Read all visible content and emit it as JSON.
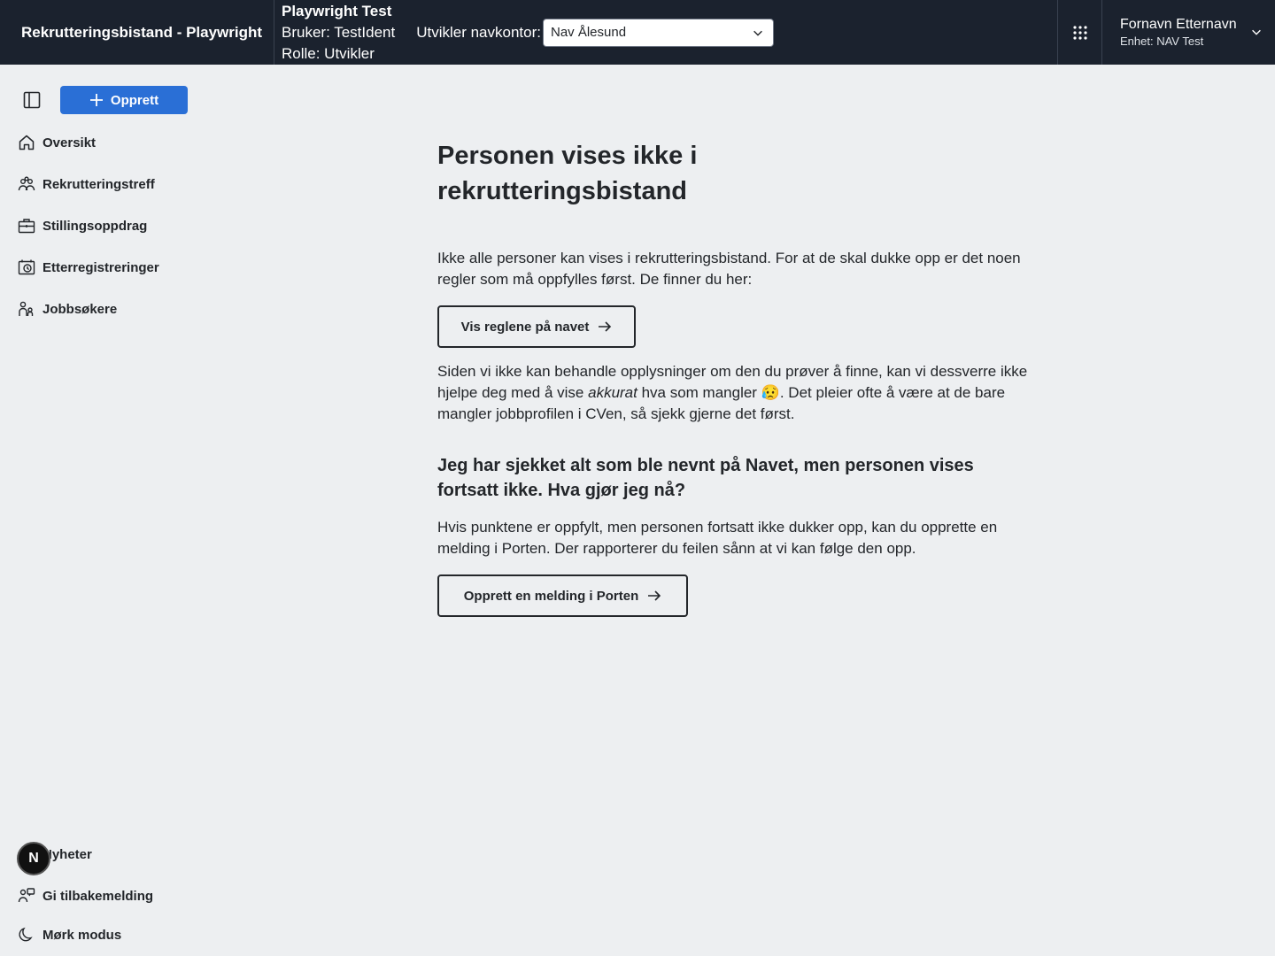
{
  "header": {
    "app_title": "Rekrutteringsbistand - Playwright",
    "dev_name": "Playwright Test",
    "dev_user": "Bruker: TestIdent",
    "dev_role": "Rolle: Utvikler",
    "navkontor_label": "Utvikler navkontor:",
    "navkontor_value": "Nav Ålesund",
    "user_name": "Fornavn Etternavn",
    "user_unit": "Enhet: NAV Test"
  },
  "sidebar": {
    "create_label": "Opprett",
    "items": [
      {
        "label": "Oversikt",
        "icon": "house-icon"
      },
      {
        "label": "Rekrutteringstreff",
        "icon": "people-icon"
      },
      {
        "label": "Stillingsoppdrag",
        "icon": "briefcase-icon"
      },
      {
        "label": "Etterregistreringer",
        "icon": "history-icon"
      },
      {
        "label": "Jobbsøkere",
        "icon": "person-group-icon"
      }
    ],
    "bottom_items": [
      {
        "label": "Nyheter",
        "icon": "megaphone-icon"
      },
      {
        "label": "Gi tilbakemelding",
        "icon": "feedback-icon"
      },
      {
        "label": "Mørk modus",
        "icon": "moon-icon"
      }
    ],
    "avatar_letter": "N"
  },
  "main": {
    "title": "Personen vises ikke i rekrutteringsbistand",
    "intro": "Ikke alle personer kan vises i rekrutteringsbistand. For at de skal dukke opp er det noen regler som må oppfylles først. De finner du her:",
    "rules_button": "Vis reglene på navet",
    "info_part1": "Siden vi ikke kan behandle opplysninger om den du prøver å finne, kan vi dessverre ikke hjelpe deg med å vise ",
    "info_em": "akkurat",
    "info_part2": " hva som mangler 😥. Det pleier ofte å være at de bare mangler jobbprofilen i CVen, så sjekk gjerne det først.",
    "subheading": "Jeg har sjekket alt som ble nevnt på Navet, men personen vises fortsatt ikke. Hva gjør jeg nå?",
    "porten_text": "Hvis punktene er oppfylt, men personen fortsatt ikke dukker opp, kan du opprette en melding i Porten. Der rapporterer du feilen sånn at vi kan følge den opp.",
    "porten_button": "Opprett en melding i Porten"
  },
  "colors": {
    "header_bg": "#1b222e",
    "page_bg": "#edeff1",
    "accent": "#2a6fd6"
  }
}
